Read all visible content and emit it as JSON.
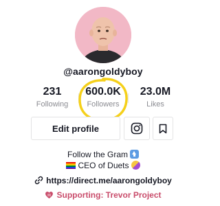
{
  "profile": {
    "username": "@aarongoldyboy",
    "avatar_icon": "profile-photo"
  },
  "stats": {
    "following": {
      "value": "231",
      "label": "Following"
    },
    "followers": {
      "value": "600.0K",
      "label": "Followers"
    },
    "likes": {
      "value": "23.0M",
      "label": "Likes"
    }
  },
  "actions": {
    "edit_profile_label": "Edit profile",
    "instagram_icon": "instagram-icon",
    "bookmark_icon": "bookmark-icon"
  },
  "bio": {
    "line1": "Follow the Gram",
    "line2": "CEO of Duets"
  },
  "link": {
    "url": "https://direct.me/aarongoldyboy",
    "icon": "link-icon"
  },
  "supporting": {
    "text": "Supporting: Trevor Project",
    "icon": "heart-icon"
  },
  "colors": {
    "highlight": "#f5d01a",
    "supporting": "#c94c6b",
    "avatar_bg": "#f2b8c6"
  }
}
